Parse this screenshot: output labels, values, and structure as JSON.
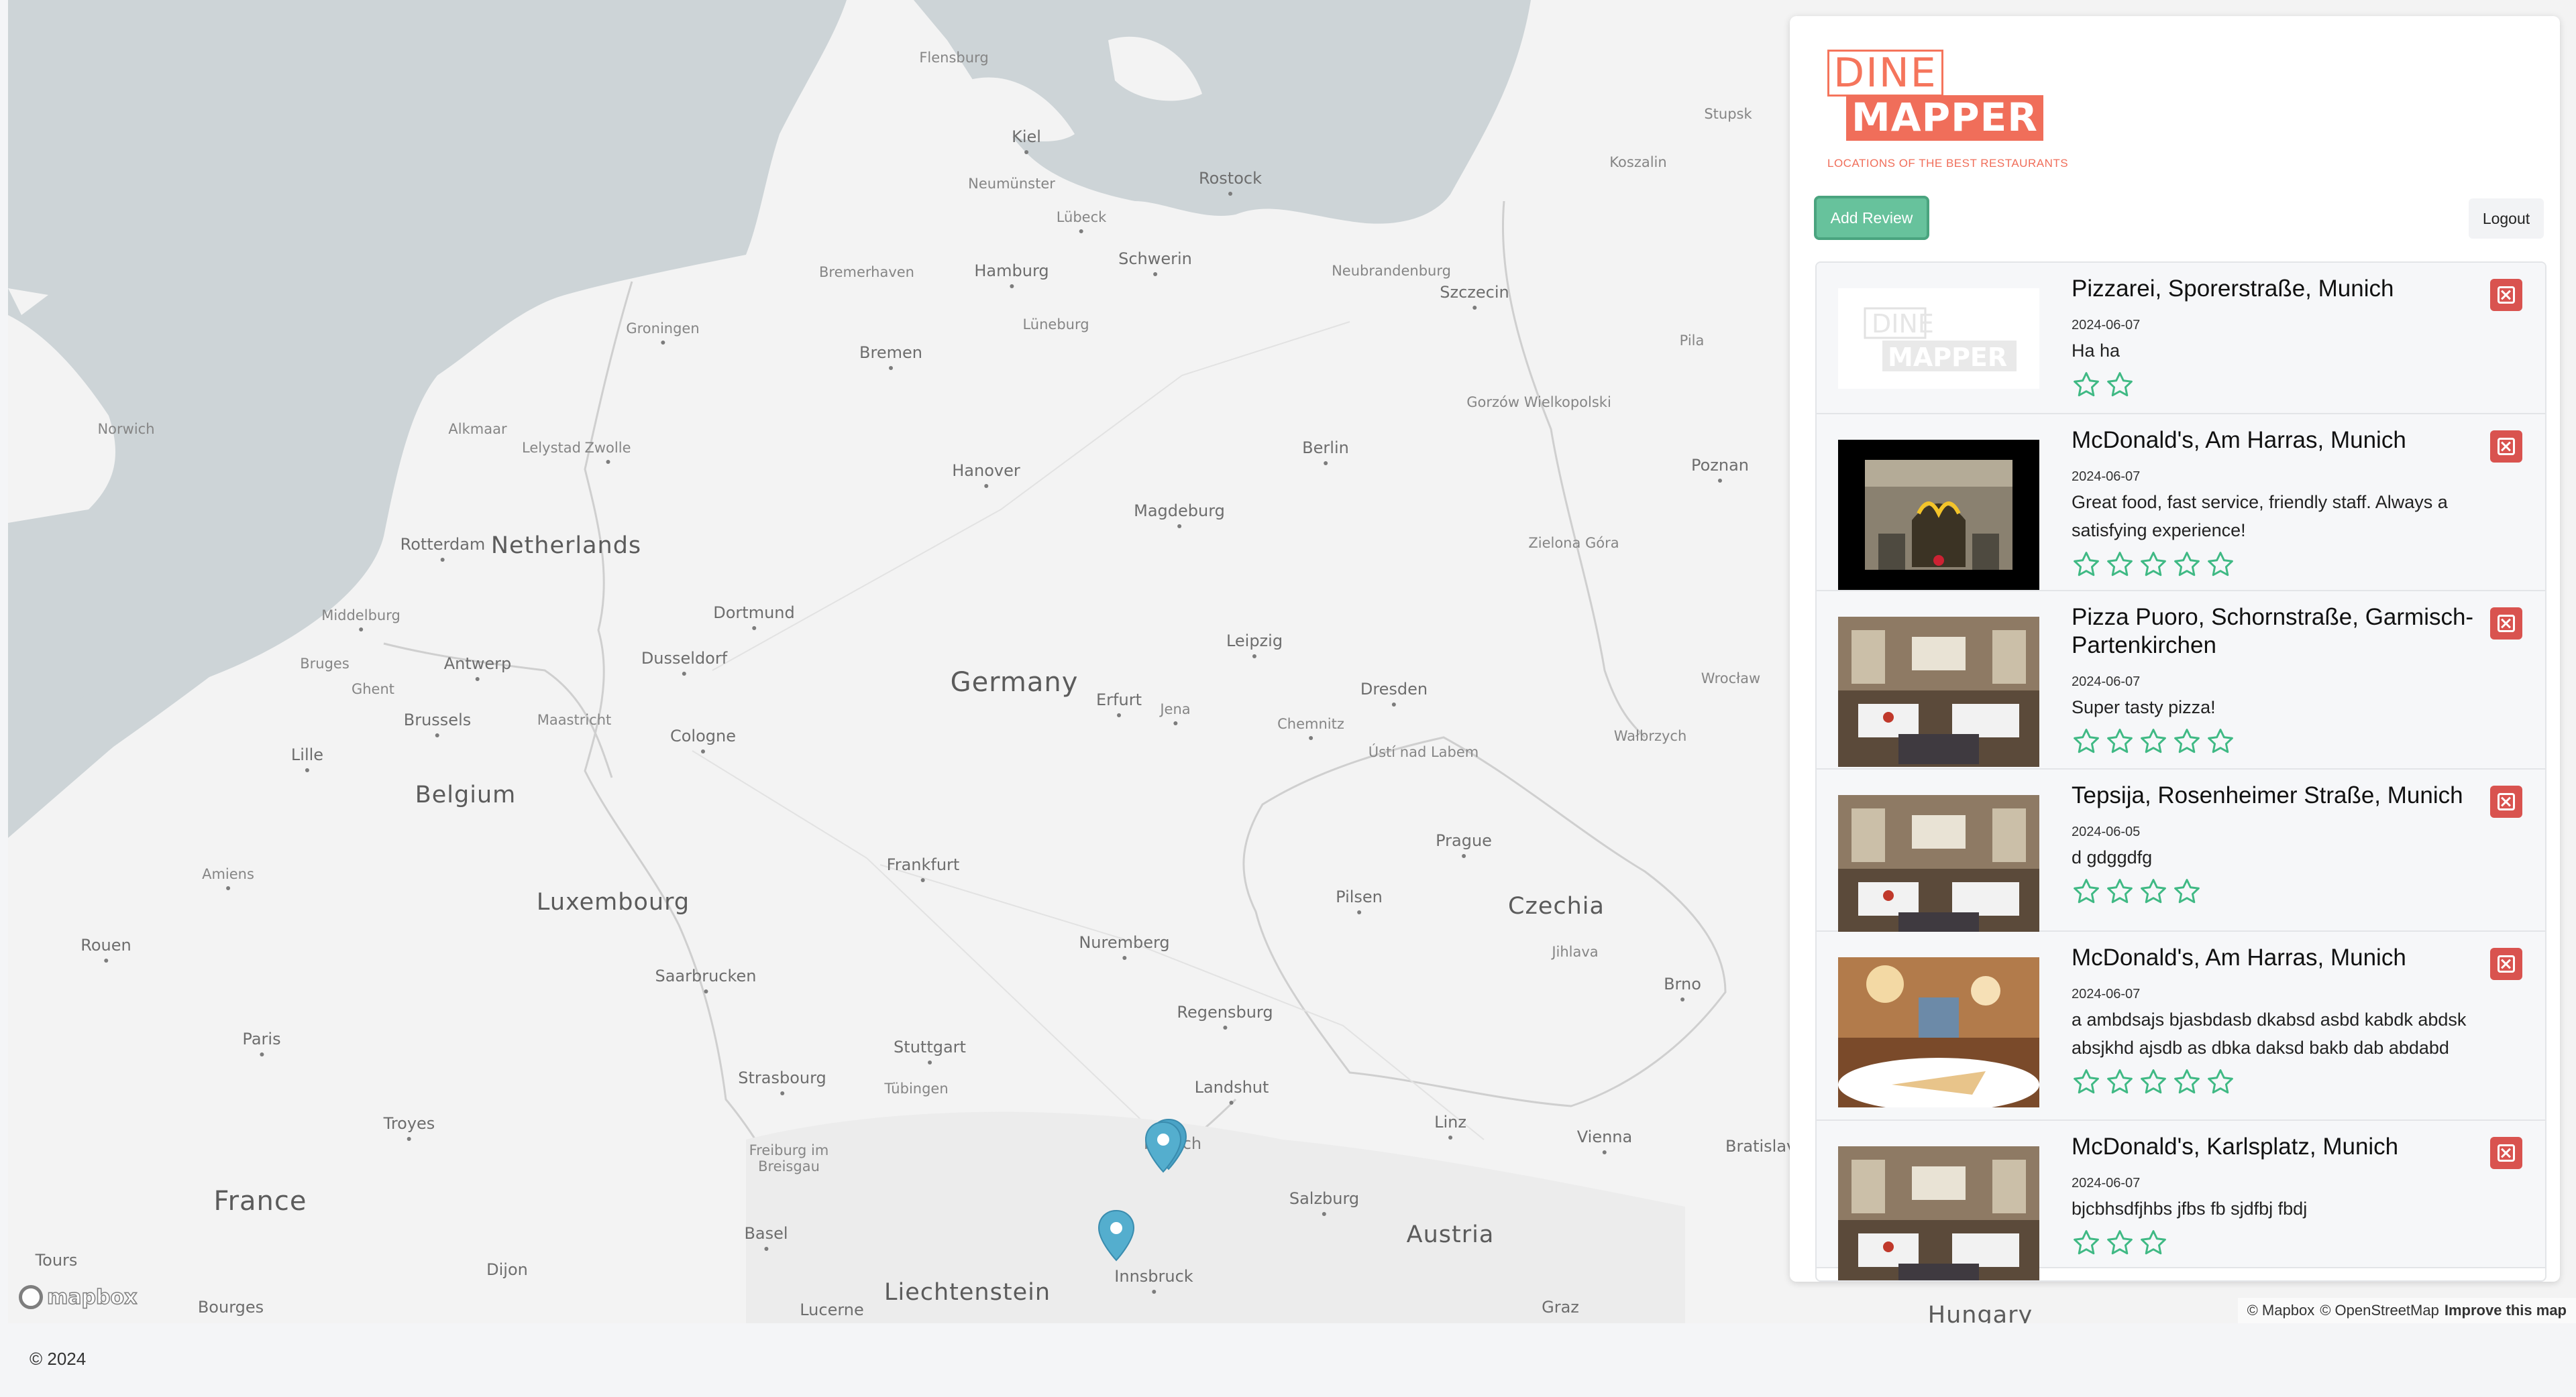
{
  "brand": {
    "line1": "DINE",
    "line2": "MAPPER",
    "tagline": "LOCATIONS OF THE BEST RESTAURANTS"
  },
  "actions": {
    "add_review": "Add Review",
    "logout": "Logout"
  },
  "reviews": [
    {
      "title": "Pizzarei, Sporerstraße, Munich",
      "date": "2024-06-07",
      "text": "Ha ha",
      "rating": 2,
      "image": "dinemapper-logo-placeholder"
    },
    {
      "title": "McDonald's, Am Harras, Munich",
      "date": "2024-06-07",
      "text": "Great food, fast service, friendly staff. Always a satisfying experience!",
      "rating": 5,
      "image": "mcdonalds-storefront-photo"
    },
    {
      "title": "Pizza Puoro, Schornstraße, Garmisch-Partenkirchen",
      "date": "2024-06-07",
      "text": "Super tasty pizza!",
      "rating": 5,
      "image": "restaurant-interior-photo"
    },
    {
      "title": "Tepsija, Rosenheimer Straße, Munich",
      "date": "2024-06-05",
      "text": "d gdggdfg",
      "rating": 4,
      "image": "restaurant-dining-photo"
    },
    {
      "title": "McDonald's, Am Harras, Munich",
      "date": "2024-06-07",
      "text": "a ambdsajs bjasbdasb dkabsd asbd kabdk abdsk absjkhd ajsdb as dbka daksd bakb dab abdabd",
      "rating": 5,
      "image": "restaurant-food-photo"
    },
    {
      "title": "McDonald's, Karlsplatz, Munich",
      "date": "2024-06-07",
      "text": "bjcbhsdfjhbs jfbs fb sjdfbj fbdj",
      "rating": 3,
      "image": "restaurant-interior-photo"
    }
  ],
  "map": {
    "countries": [
      "Netherlands",
      "Germany",
      "Belgium",
      "Luxembourg",
      "France",
      "Czechia",
      "Austria",
      "Liechtenstein",
      "Hungary"
    ],
    "cities": [
      "Flensburg",
      "Kiel",
      "Neumünster",
      "Rostock",
      "Lübeck",
      "Stupsk",
      "Koszalin",
      "Hamburg",
      "Schwerin",
      "Bremerhaven",
      "Neubrandenburg",
      "Szczecin",
      "Groningen",
      "Lüneburg",
      "Bremen",
      "Pila",
      "Norwich",
      "Alkmaar",
      "Lelystad",
      "Zwolle",
      "Gorzów Wielkopolski",
      "Hanover",
      "Berlin",
      "Poznan",
      "Rotterdam",
      "Magdeburg",
      "Zielona Góra",
      "Middelburg",
      "Dortmund",
      "Bruges",
      "Antwerp",
      "Dusseldorf",
      "Leipzig",
      "Ghent",
      "Erfurt",
      "Dresden",
      "Wrocław",
      "Brussels",
      "Maastricht",
      "Jena",
      "Chemnitz",
      "Cologne",
      "Lille",
      "Ústí nad Labem",
      "Wałbrzych",
      "Frankfurt",
      "Prague",
      "Amiens",
      "Pilsen",
      "Rouen",
      "Nuremberg",
      "Jihlava",
      "Saarbrucken",
      "Regensburg",
      "Brno",
      "Paris",
      "Stuttgart",
      "Strasbourg",
      "Landshut",
      "Tübingen",
      "Troyes",
      "Linz",
      "Freiburg im Breisgau",
      "Vienna",
      "Bratislava",
      "Salzburg",
      "Basel",
      "Tours",
      "Dijon",
      "Innsbruck",
      "Bourges",
      "Lucerne",
      "Graz",
      "Munich"
    ],
    "attribution": {
      "mapbox": "© Mapbox",
      "osm": "© OpenStreetMap",
      "improve": "Improve this map"
    },
    "logo": "mapbox"
  },
  "footer": {
    "copyright": "© 2024"
  },
  "colors": {
    "accent": "#67c29c",
    "brand": "#f06e5a",
    "danger": "#d9534f",
    "star": "#3fb984",
    "pin": "#4aa3c6",
    "water": "#cdd4d7"
  }
}
